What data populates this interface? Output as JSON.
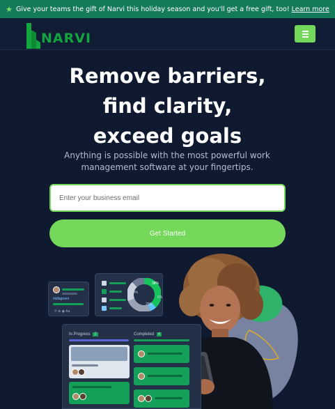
{
  "promo": {
    "message": "Give your teams the gift of Narvi this holiday season and you'll get a free gift, too!",
    "link": "Learn more"
  },
  "header": {
    "logo_text": "NARVI",
    "menu_icon": "hamburger-menu-icon"
  },
  "hero": {
    "title_line1": "Remove barriers,",
    "title_line2": "find clarity,",
    "title_line3": "exceed goals",
    "subtitle_line1": "Anything is possible with the most powerful work",
    "subtitle_line2": "management software at your fingertips.",
    "email_placeholder": "Enter your business email",
    "cta_label": "Get Started"
  },
  "illustration": {
    "profile_card_label": "#allagreen",
    "kanban_in_progress": "In Progress",
    "kanban_in_progress_count": "2",
    "kanban_completed": "Completed",
    "kanban_completed_count": "4",
    "donut_label_top": "38%",
    "donut_label_left": "19%",
    "donut_label_bottom": "25%",
    "donut_label_right": "6%",
    "colors": {
      "accent": "#74d95a",
      "promo_bg": "#157a5a",
      "page_bg": "#0f1a30"
    }
  }
}
